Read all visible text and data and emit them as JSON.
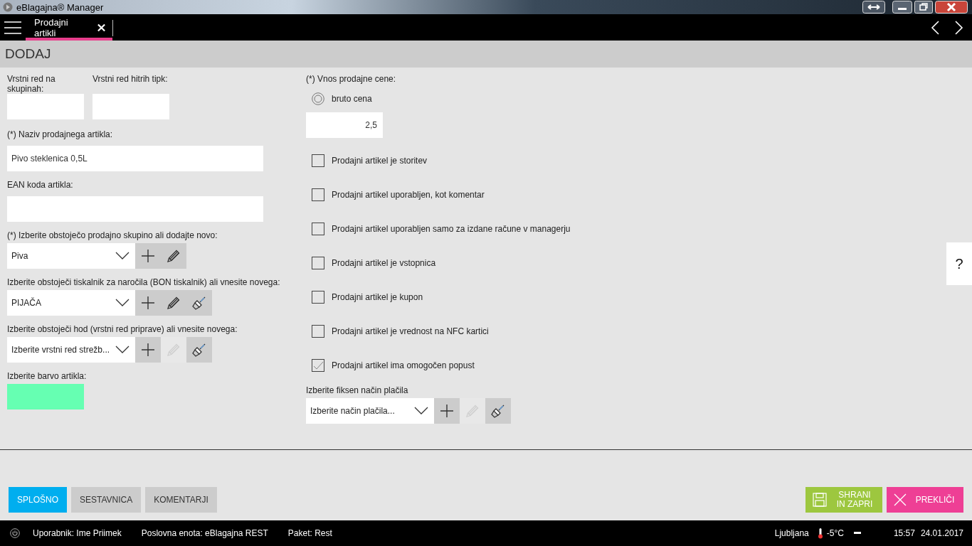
{
  "window": {
    "title": "eBlagajna® Manager"
  },
  "tabs": [
    {
      "label": "Prodajni artikli",
      "selected": true
    }
  ],
  "page_title": "DODAJ",
  "order_fields": [
    {
      "label": "Vrstni red na skupinah:"
    },
    {
      "label": "Vrstni red hitrih tipk:"
    }
  ],
  "name_field": {
    "label": "(*) Naziv prodajnega artikla:",
    "value": "Pivo steklenica 0,5L"
  },
  "ean_field": {
    "label": "EAN koda artikla:"
  },
  "selects": [
    {
      "label": "(*) Izberite obstoječo prodajno skupino ali dodajte novo:",
      "value": "Piva",
      "buttons": [
        {
          "kind": "add",
          "disabled": false
        },
        {
          "kind": "edit",
          "disabled": false
        }
      ]
    },
    {
      "label": "Izberite obstoječi tiskalnik za naročila (BON tiskalnik) ali vnesite novega:",
      "value": "PIJAČA",
      "buttons": [
        {
          "kind": "add",
          "disabled": false
        },
        {
          "kind": "edit",
          "disabled": false
        },
        {
          "kind": "brush",
          "disabled": false
        }
      ]
    },
    {
      "label": "Izberite obstoječi hod (vrstni red priprave) ali vnesite novega:",
      "placeholder": "Izberite vrstni red strežb...",
      "buttons": [
        {
          "kind": "add",
          "disabled": false
        },
        {
          "kind": "edit",
          "disabled": true
        },
        {
          "kind": "brush",
          "disabled": false
        }
      ]
    }
  ],
  "color_field": {
    "label": "Izberite barvo artikla:",
    "color": "#66ffb2"
  },
  "price": {
    "label": "(*) Vnos prodajne cene:",
    "option": {
      "label": "bruto cena",
      "selected": true
    },
    "value": "2,5"
  },
  "checkboxes": [
    {
      "label": "Prodajni artikel je storitev",
      "checked": false
    },
    {
      "label": "Prodajni artikel uporabljen, kot komentar",
      "checked": false
    },
    {
      "label": "Prodajni artikel uporabljen samo za izdane račune v managerju",
      "checked": false
    },
    {
      "label": "Prodajni artikel je vstopnica",
      "checked": false
    },
    {
      "label": "Prodajni artikel je kupon",
      "checked": false
    },
    {
      "label": "Prodajni artikel je vrednost na NFC kartici",
      "checked": false
    },
    {
      "label": "Prodajni artikel ima omogočen popust",
      "checked": true
    }
  ],
  "payment_select": {
    "label": "Izberite fiksen način plačila",
    "placeholder": "Izberite način plačila...",
    "buttons": [
      {
        "kind": "add",
        "disabled": false
      },
      {
        "kind": "edit",
        "disabled": true
      },
      {
        "kind": "brush",
        "disabled": false
      }
    ]
  },
  "help": {
    "label": "?"
  },
  "bottom_tabs": [
    {
      "label": "SPLOŠNO",
      "selected": true
    },
    {
      "label": "SESTAVNICA",
      "selected": false
    },
    {
      "label": "KOMENTARJI",
      "selected": false
    }
  ],
  "actions": [
    {
      "kind": "save",
      "label": "SHRANI IN ZAPRI"
    },
    {
      "kind": "cancel",
      "label": "PREKLIČI"
    }
  ],
  "status_bar": {
    "user": "Uporabnik: Ime Priimek",
    "unit": "Poslovna enota: eBlagajna REST",
    "package": "Paket: Rest",
    "city": "Ljubljana",
    "temperature": "-5°C",
    "time": "15:57",
    "date": "24.01.2017"
  }
}
